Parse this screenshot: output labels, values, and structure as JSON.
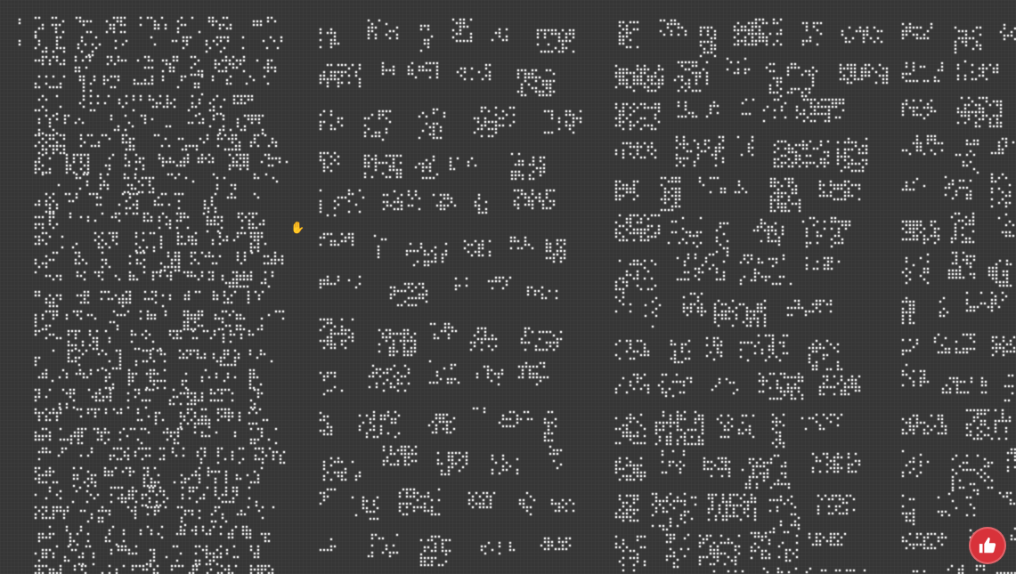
{
  "canvas": {
    "background_color": "#363636",
    "grid_color": "#444444",
    "grid_major_color": "#4a4a4a",
    "dot_color": "#d8d8d8",
    "content": "conway-life-pattern-catalog",
    "columns": 4,
    "vertical_scrollbar": "none"
  },
  "cursor": {
    "icon": "hand-pointer-icon"
  },
  "like_button": {
    "icon": "thumbs-up-icon",
    "color": "#d8323a"
  }
}
